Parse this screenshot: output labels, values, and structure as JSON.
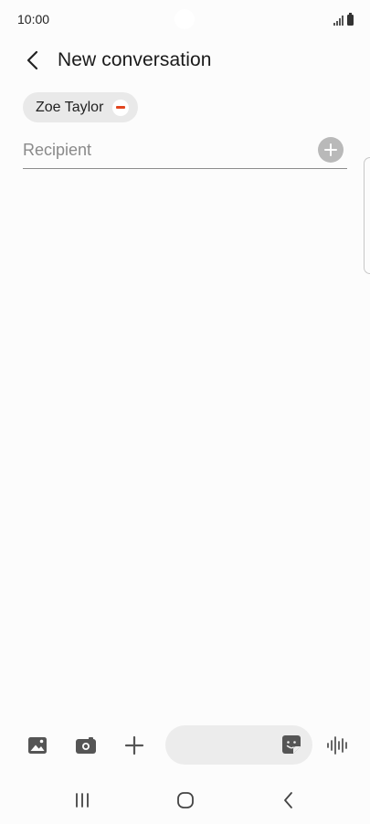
{
  "status_bar": {
    "time": "10:00"
  },
  "header": {
    "title": "New conversation",
    "back_icon": "chevron-left-icon"
  },
  "recipients": [
    {
      "name": "Zoe Taylor",
      "remove_icon": "minus-circle-icon"
    }
  ],
  "recipient_field": {
    "value": "",
    "placeholder": "Recipient",
    "add_icon": "plus-circle-icon"
  },
  "composer": {
    "message_value": "",
    "tools": [
      "gallery-icon",
      "camera-icon",
      "plus-icon"
    ],
    "sticker_icon": "sticker-icon",
    "voice_icon": "voice-waveform-icon"
  },
  "navigation": {
    "buttons": [
      "recents-icon",
      "home-icon",
      "back-icon"
    ]
  },
  "colors": {
    "background": "#fcfcfc",
    "chip_background": "#e9e9e9",
    "remove_accent": "#e2451f",
    "add_button": "#b9b9b9",
    "icon_gray": "#555555"
  }
}
